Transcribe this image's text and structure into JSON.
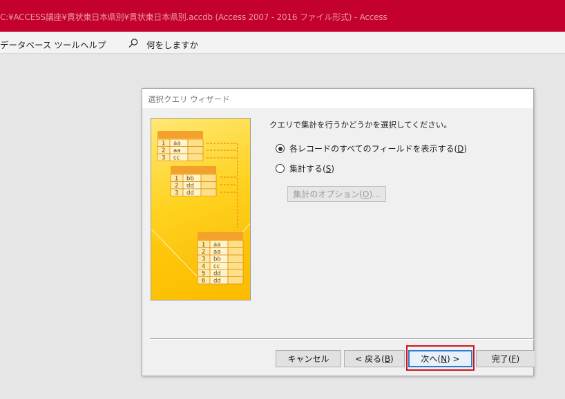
{
  "window": {
    "title": "C:¥ACCESS講座¥貫状東日本県別¥貫状東日本県別.accdb (Access 2007 - 2016 ファイル形式)  -  Access"
  },
  "menubar": {
    "items": [
      "データベース ツール",
      "ヘルプ"
    ],
    "search_placeholder": "何をしますか"
  },
  "dialog": {
    "title": "選択クエリ ウィザード",
    "prompt": "クエリで集計を行うかどうかを選択してください。",
    "options": [
      {
        "label_pre": "各レコードのすべてのフィールドを表示する(",
        "key": "D",
        "label_post": ")",
        "selected": true
      },
      {
        "label_pre": "集計する(",
        "key": "S",
        "label_post": ")",
        "selected": false
      }
    ],
    "summary_options_button": {
      "label_pre": "集計のオプション(",
      "key": "O",
      "label_post": ")...",
      "enabled": false
    },
    "buttons": {
      "cancel": "キャンセル",
      "back": {
        "pre": "< 戻る(",
        "key": "B",
        "post": ")"
      },
      "next": {
        "pre": "次へ(",
        "key": "N",
        "post": ") >"
      },
      "finish": {
        "pre": "完了(",
        "key": "F",
        "post": ")"
      }
    }
  },
  "illustration": {
    "table1": [
      [
        "1",
        "aa"
      ],
      [
        "2",
        "aa"
      ],
      [
        "3",
        "cc"
      ]
    ],
    "table2": [
      [
        "1",
        "bb"
      ],
      [
        "2",
        "dd"
      ],
      [
        "3",
        "dd"
      ]
    ],
    "table3": [
      [
        "1",
        "aa"
      ],
      [
        "2",
        "aa"
      ],
      [
        "3",
        "bb"
      ],
      [
        "4",
        "cc"
      ],
      [
        "5",
        "dd"
      ],
      [
        "6",
        "dd"
      ]
    ]
  },
  "colors": {
    "titlebar": "#c4002f",
    "highlight": "#d0141c",
    "default_button_border": "#2b7bd3",
    "illustration_gold": "#ffd21e"
  }
}
